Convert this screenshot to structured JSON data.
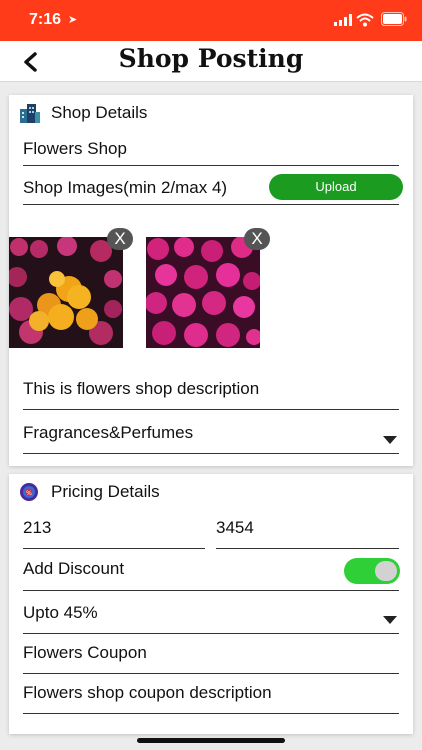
{
  "status_bar": {
    "time": "7:16",
    "location_arrow": "➤"
  },
  "nav": {
    "title": "Shop Posting",
    "back_icon": "chevron-left-icon"
  },
  "shop_details": {
    "title": "Shop Details",
    "icon": "buildings-icon",
    "shop_name": "Flowers Shop",
    "images_label": "Shop Images(min 2/max 4)",
    "upload_label": "Upload",
    "remove_label": "X",
    "description": "This is flowers shop description",
    "category": "Fragrances&Perfumes"
  },
  "pricing_details": {
    "title": "Pricing Details",
    "icon": "discount-badge-icon",
    "price_1": "213",
    "price_2": "3454",
    "discount_label": "Add Discount",
    "discount_enabled": true,
    "discount_value": "Upto 45%",
    "coupon_name": "Flowers Coupon",
    "coupon_description": "Flowers shop coupon description"
  },
  "colors": {
    "status_bar": "#ff3b1a",
    "upload_button": "#1c9b21",
    "toggle_on": "#2fcf37"
  }
}
